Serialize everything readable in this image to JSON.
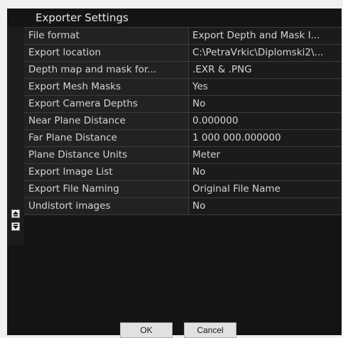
{
  "header": {
    "title": "Exporter Settings"
  },
  "properties": [
    {
      "label": "File format",
      "value": "Export Depth and Mask I..."
    },
    {
      "label": "Export location",
      "value": "C:\\PetraVrkic\\Diplomski2\\..."
    },
    {
      "label": "Depth map and mask for...",
      "value": ".EXR & .PNG"
    },
    {
      "label": "Export Mesh Masks",
      "value": "Yes"
    },
    {
      "label": "Export Camera Depths",
      "value": "No"
    },
    {
      "label": "Near Plane Distance",
      "value": "0.000000"
    },
    {
      "label": "Far Plane Distance",
      "value": "1 000 000.000000"
    },
    {
      "label": "Plane Distance Units",
      "value": "Meter"
    },
    {
      "label": "Export Image List",
      "value": "No"
    },
    {
      "label": "Export File Naming",
      "value": "Original File Name"
    },
    {
      "label": "Undistort images",
      "value": "No"
    }
  ],
  "buttons": {
    "ok": "OK",
    "cancel": "Cancel"
  },
  "icons": {
    "scroll_up": "arrow-up-icon",
    "scroll_down": "arrow-down-icon"
  }
}
